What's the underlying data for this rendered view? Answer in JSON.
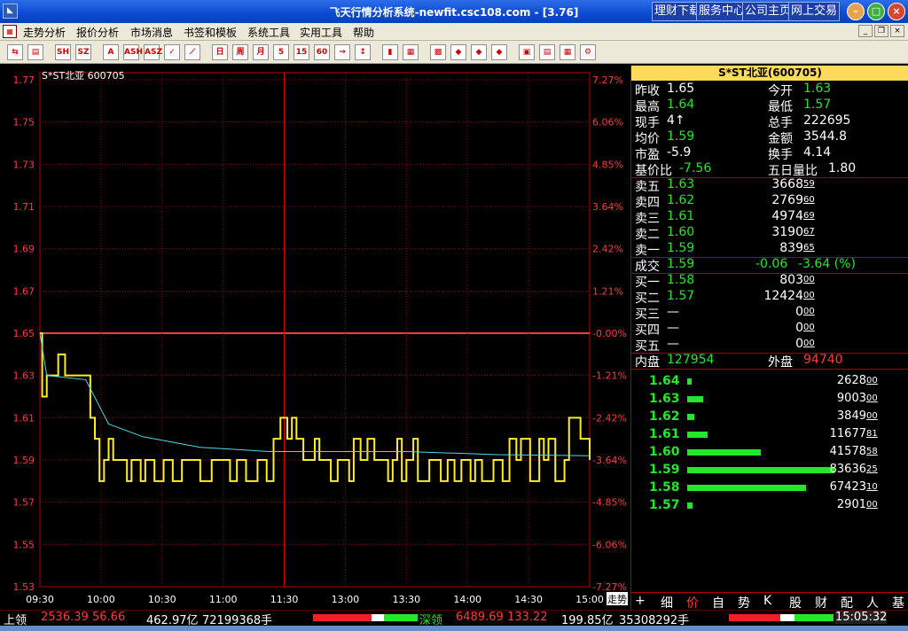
{
  "window": {
    "title": "飞天行情分析系统-newfit.csc108.com - [3.76]",
    "app_icon": "chart-app-icon",
    "top_links": [
      "理财下载",
      "服务中心",
      "公司主页",
      "网上交易"
    ]
  },
  "menu": [
    "走势分析",
    "报价分析",
    "市场消息",
    "书签和模板",
    "系统工具",
    "实用工具",
    "帮助"
  ],
  "toolbar": {
    "buttons": [
      "back",
      "tile",
      "sh-index",
      "sz-index",
      "index-a",
      "index-ash",
      "index-asz",
      "check",
      "line-chart",
      "candle-day",
      "candle-week",
      "candle-month",
      "candle-5min",
      "candle-15min",
      "candle-60min",
      "arrow-right",
      "tick",
      "bars",
      "table-a",
      "table-b",
      "ball-a",
      "ball-b",
      "ball-c",
      "book",
      "doc",
      "print",
      "settings"
    ]
  },
  "chart": {
    "stock_label": "S*ST北亚  600705",
    "prev_close": 1.65,
    "y_labels": [
      "1.77",
      "1.75",
      "1.73",
      "1.71",
      "1.69",
      "1.67",
      "1.65",
      "1.63",
      "1.61",
      "1.59",
      "1.57",
      "1.55",
      "1.53"
    ],
    "pct_labels": [
      "7.27%",
      "6.06%",
      "4.85%",
      "3.64%",
      "2.42%",
      "1.21%",
      "-0.00%",
      "-1.21%",
      "-2.42%",
      "-3.64%",
      "-4.85%",
      "-6.06%",
      "-7.27%"
    ],
    "x_labels": [
      "09:30",
      "10:00",
      "10:30",
      "11:00",
      "11:30",
      "13:00",
      "13:30",
      "14:00",
      "14:30",
      "15:00"
    ],
    "price_line": [
      [
        0,
        1.65
      ],
      [
        1,
        1.62
      ],
      [
        3,
        1.63
      ],
      [
        7,
        1.63
      ],
      [
        8,
        1.64
      ],
      [
        10,
        1.64
      ],
      [
        11,
        1.63
      ],
      [
        20,
        1.63
      ],
      [
        22,
        1.61
      ],
      [
        24,
        1.6
      ],
      [
        26,
        1.58
      ],
      [
        28,
        1.59
      ],
      [
        30,
        1.6
      ],
      [
        32,
        1.59
      ],
      [
        36,
        1.59
      ],
      [
        38,
        1.58
      ],
      [
        40,
        1.59
      ],
      [
        44,
        1.58
      ],
      [
        46,
        1.59
      ],
      [
        50,
        1.58
      ],
      [
        54,
        1.59
      ],
      [
        58,
        1.58
      ],
      [
        62,
        1.59
      ],
      [
        70,
        1.58
      ],
      [
        75,
        1.59
      ],
      [
        80,
        1.59
      ],
      [
        83,
        1.58
      ],
      [
        86,
        1.59
      ],
      [
        90,
        1.58
      ],
      [
        95,
        1.59
      ],
      [
        99,
        1.58
      ],
      [
        102,
        1.6
      ],
      [
        105,
        1.61
      ],
      [
        108,
        1.6
      ],
      [
        110,
        1.61
      ],
      [
        112,
        1.6
      ],
      [
        115,
        1.59
      ],
      [
        118,
        1.59
      ],
      [
        120,
        1.6
      ],
      [
        122,
        1.59
      ],
      [
        125,
        1.59
      ],
      [
        127,
        1.58
      ],
      [
        130,
        1.59
      ],
      [
        135,
        1.58
      ],
      [
        137,
        1.6
      ],
      [
        140,
        1.59
      ],
      [
        143,
        1.6
      ],
      [
        146,
        1.59
      ],
      [
        150,
        1.59
      ],
      [
        152,
        1.58
      ],
      [
        154,
        1.59
      ],
      [
        156,
        1.6
      ],
      [
        158,
        1.58
      ],
      [
        160,
        1.59
      ],
      [
        163,
        1.6
      ],
      [
        165,
        1.58
      ],
      [
        170,
        1.59
      ],
      [
        175,
        1.58
      ],
      [
        178,
        1.59
      ],
      [
        181,
        1.58
      ],
      [
        184,
        1.59
      ],
      [
        188,
        1.58
      ],
      [
        190,
        1.59
      ],
      [
        193,
        1.58
      ],
      [
        198,
        1.59
      ],
      [
        202,
        1.58
      ],
      [
        205,
        1.6
      ],
      [
        208,
        1.59
      ],
      [
        210,
        1.6
      ],
      [
        214,
        1.58
      ],
      [
        218,
        1.6
      ],
      [
        220,
        1.59
      ],
      [
        222,
        1.6
      ],
      [
        225,
        1.58
      ],
      [
        229,
        1.59
      ],
      [
        231,
        1.61
      ],
      [
        234,
        1.61
      ],
      [
        236,
        1.6
      ],
      [
        240,
        1.6
      ],
      [
        242,
        1.59
      ],
      [
        244,
        1.6
      ],
      [
        246,
        1.59
      ],
      [
        248,
        1.6
      ],
      [
        250,
        1.59
      ],
      [
        252,
        1.6
      ],
      [
        254,
        1.59
      ],
      [
        256,
        1.6
      ],
      [
        258,
        1.59
      ],
      [
        260,
        1.6
      ],
      [
        263,
        1.59
      ],
      [
        265,
        1.58
      ],
      [
        268,
        1.59
      ],
      [
        270,
        1.6
      ],
      [
        272,
        1.58
      ],
      [
        274,
        1.6
      ],
      [
        276,
        1.59
      ],
      [
        278,
        1.58
      ],
      [
        280,
        1.59
      ],
      [
        284,
        1.6
      ],
      [
        287,
        1.58
      ],
      [
        290,
        1.59
      ],
      [
        295,
        1.58
      ],
      [
        300,
        1.59
      ],
      [
        305,
        1.6
      ],
      [
        310,
        1.59
      ],
      [
        315,
        1.6
      ],
      [
        320,
        1.59
      ],
      [
        325,
        1.58
      ],
      [
        330,
        1.59
      ],
      [
        335,
        1.58
      ],
      [
        338,
        1.59
      ],
      [
        340,
        1.58
      ],
      [
        345,
        1.59
      ],
      [
        350,
        1.58
      ],
      [
        355,
        1.59
      ],
      [
        360,
        1.58
      ],
      [
        365,
        1.59
      ],
      [
        370,
        1.6
      ],
      [
        375,
        1.59
      ],
      [
        380,
        1.58
      ],
      [
        385,
        1.59
      ],
      [
        390,
        1.58
      ],
      [
        395,
        1.59
      ],
      [
        400,
        1.58
      ],
      [
        405,
        1.59
      ],
      [
        410,
        1.6
      ],
      [
        415,
        1.59
      ],
      [
        420,
        1.58
      ],
      [
        425,
        1.59
      ],
      [
        430,
        1.58
      ],
      [
        435,
        1.59
      ],
      [
        440,
        1.58
      ],
      [
        445,
        1.59
      ],
      [
        450,
        1.58
      ],
      [
        455,
        1.59
      ],
      [
        460,
        1.58
      ],
      [
        465,
        1.59
      ],
      [
        470,
        1.58
      ],
      [
        475,
        1.59
      ],
      [
        480,
        1.58
      ],
      [
        485,
        1.59
      ],
      [
        490,
        1.58
      ],
      [
        495,
        1.59
      ],
      [
        500,
        1.58
      ],
      [
        505,
        1.59
      ],
      [
        510,
        1.58
      ],
      [
        515,
        1.59
      ],
      [
        520,
        1.58
      ],
      [
        525,
        1.59
      ],
      [
        530,
        1.58
      ],
      [
        535,
        1.59
      ],
      [
        540,
        1.58
      ],
      [
        545,
        1.59
      ],
      [
        550,
        1.58
      ],
      [
        555,
        1.59
      ],
      [
        560,
        1.58
      ],
      [
        565,
        1.59
      ],
      [
        570,
        1.58
      ],
      [
        575,
        1.59
      ],
      [
        580,
        1.58
      ],
      [
        585,
        1.59
      ],
      [
        590,
        1.58
      ],
      [
        595,
        1.59
      ],
      [
        600,
        1.58
      ],
      [
        605,
        1.59
      ],
      [
        610,
        1.58
      ],
      [
        615,
        1.59
      ],
      [
        620,
        1.58
      ],
      [
        625,
        1.59
      ],
      [
        630,
        1.58
      ],
      [
        635,
        1.59
      ],
      [
        640,
        1.58
      ],
      [
        645,
        1.59
      ],
      [
        650,
        1.58
      ],
      [
        655,
        1.59
      ],
      [
        660,
        1.58
      ],
      [
        665,
        1.59
      ],
      [
        670,
        1.58
      ],
      [
        675,
        1.59
      ],
      [
        680,
        1.58
      ],
      [
        685,
        1.59
      ],
      [
        690,
        1.58
      ],
      [
        695,
        1.59
      ],
      [
        700,
        1.58
      ],
      [
        705,
        1.59
      ],
      [
        710,
        1.58
      ],
      [
        715,
        1.59
      ],
      [
        720,
        1.58
      ],
      [
        725,
        1.59
      ],
      [
        730,
        1.58
      ],
      [
        735,
        1.59
      ],
      [
        740,
        1.58
      ],
      [
        745,
        1.59
      ],
      [
        750,
        1.58
      ],
      [
        755,
        1.59
      ],
      [
        760,
        1.58
      ],
      [
        765,
        1.59
      ],
      [
        770,
        1.58
      ],
      [
        775,
        1.59
      ],
      [
        780,
        1.58
      ],
      [
        785,
        1.59
      ],
      [
        790,
        1.58
      ],
      [
        795,
        1.59
      ],
      [
        800,
        1.58
      ],
      [
        805,
        1.59
      ],
      [
        810,
        1.58
      ],
      [
        815,
        1.59
      ],
      [
        820,
        1.58
      ],
      [
        825,
        1.59
      ],
      [
        830,
        1.58
      ],
      [
        835,
        1.59
      ],
      [
        840,
        1.58
      ],
      [
        845,
        1.59
      ],
      [
        850,
        1.58
      ],
      [
        855,
        1.59
      ],
      [
        860,
        1.58
      ],
      [
        865,
        1.59
      ],
      [
        870,
        1.58
      ],
      [
        875,
        1.59
      ],
      [
        880,
        1.58
      ],
      [
        885,
        1.59
      ],
      [
        890,
        1.58
      ],
      [
        895,
        1.59
      ],
      [
        900,
        1.58
      ],
      [
        905,
        1.59
      ],
      [
        910,
        1.58
      ],
      [
        915,
        1.59
      ],
      [
        920,
        1.58
      ],
      [
        925,
        1.59
      ],
      [
        930,
        1.58
      ],
      [
        935,
        1.59
      ],
      [
        940,
        1.58
      ],
      [
        945,
        1.59
      ],
      [
        950,
        1.58
      ],
      [
        955,
        1.59
      ],
      [
        960,
        1.58
      ],
      [
        965,
        1.59
      ],
      [
        970,
        1.58
      ],
      [
        975,
        1.59
      ],
      [
        980,
        1.58
      ],
      [
        985,
        1.59
      ],
      [
        990,
        1.58
      ],
      [
        995,
        1.59
      ],
      [
        1000,
        1.58
      ]
    ]
  },
  "panel": {
    "title": "S*ST北亚(600705)",
    "quote": [
      {
        "l": "昨收",
        "v": "1.65",
        "c": "w",
        "l2": "今开",
        "v2": "1.63",
        "c2": "g"
      },
      {
        "l": "最高",
        "v": "1.64",
        "c": "g",
        "l2": "最低",
        "v2": "1.57",
        "c2": "g"
      },
      {
        "l": "现手",
        "v": "4↑",
        "c": "w",
        "l2": "总手",
        "v2": "222695",
        "c2": "w"
      },
      {
        "l": "均价",
        "v": "1.59",
        "c": "g",
        "l2": "金额",
        "v2": "3544.8",
        "c2": "w"
      },
      {
        "l": "市盈",
        "v": "-5.9",
        "c": "w",
        "l2": "换手",
        "v2": "4.14",
        "c2": "w"
      },
      {
        "l": "基价比",
        "v": "-7.56",
        "c": "g",
        "l2": "五日量比",
        "v2": "1.80",
        "c2": "w"
      }
    ],
    "sell": [
      {
        "l": "卖五",
        "p": "1.63",
        "v": "3668",
        "s": "59"
      },
      {
        "l": "卖四",
        "p": "1.62",
        "v": "2769",
        "s": "60"
      },
      {
        "l": "卖三",
        "p": "1.61",
        "v": "4974",
        "s": "69"
      },
      {
        "l": "卖二",
        "p": "1.60",
        "v": "3190",
        "s": "67"
      },
      {
        "l": "卖一",
        "p": "1.59",
        "v": "839",
        "s": "65"
      }
    ],
    "trade": {
      "l": "成交",
      "p": "1.59",
      "chg": "-0.06",
      "pct": "-3.64 (%)"
    },
    "buy": [
      {
        "l": "买一",
        "p": "1.58",
        "v": "803",
        "s": "00"
      },
      {
        "l": "买二",
        "p": "1.57",
        "v": "12424",
        "s": "00"
      },
      {
        "l": "买三",
        "p": "—",
        "v": "0",
        "s": "00"
      },
      {
        "l": "买四",
        "p": "—",
        "v": "0",
        "s": "00"
      },
      {
        "l": "买五",
        "p": "—",
        "v": "0",
        "s": "00"
      }
    ],
    "inner": {
      "l": "内盘",
      "v": "127954",
      "l2": "外盘",
      "v2": "94740"
    },
    "volume_by_price": [
      {
        "p": "1.64",
        "v": "2628",
        "s": "00",
        "amount": 2628
      },
      {
        "p": "1.63",
        "v": "9003",
        "s": "00",
        "amount": 9003
      },
      {
        "p": "1.62",
        "v": "3849",
        "s": "00",
        "amount": 3849
      },
      {
        "p": "1.61",
        "v": "11677",
        "s": "81",
        "amount": 11677
      },
      {
        "p": "1.60",
        "v": "41578",
        "s": "58",
        "amount": 41578
      },
      {
        "p": "1.59",
        "v": "83636",
        "s": "25",
        "amount": 83636
      },
      {
        "p": "1.58",
        "v": "67423",
        "s": "10",
        "amount": 67423
      },
      {
        "p": "1.57",
        "v": "2901",
        "s": "00",
        "amount": 2901
      }
    ],
    "tabs": [
      "+",
      "细",
      "价",
      "自",
      "势",
      "K",
      "股",
      "财",
      "配",
      "人",
      "基"
    ],
    "chart_tab": "走势"
  },
  "status": {
    "sh_label": "上领",
    "sh_index": "2536.39",
    "sh_chg": "56.66",
    "sh_amount": "462.97亿",
    "sh_vol": "72199368手",
    "sz_label": "深领",
    "sz_index": "6489.69",
    "sz_chg": "133.22",
    "sz_amount": "199.85亿",
    "sz_vol": "35308292手",
    "time": "15:05:32"
  }
}
